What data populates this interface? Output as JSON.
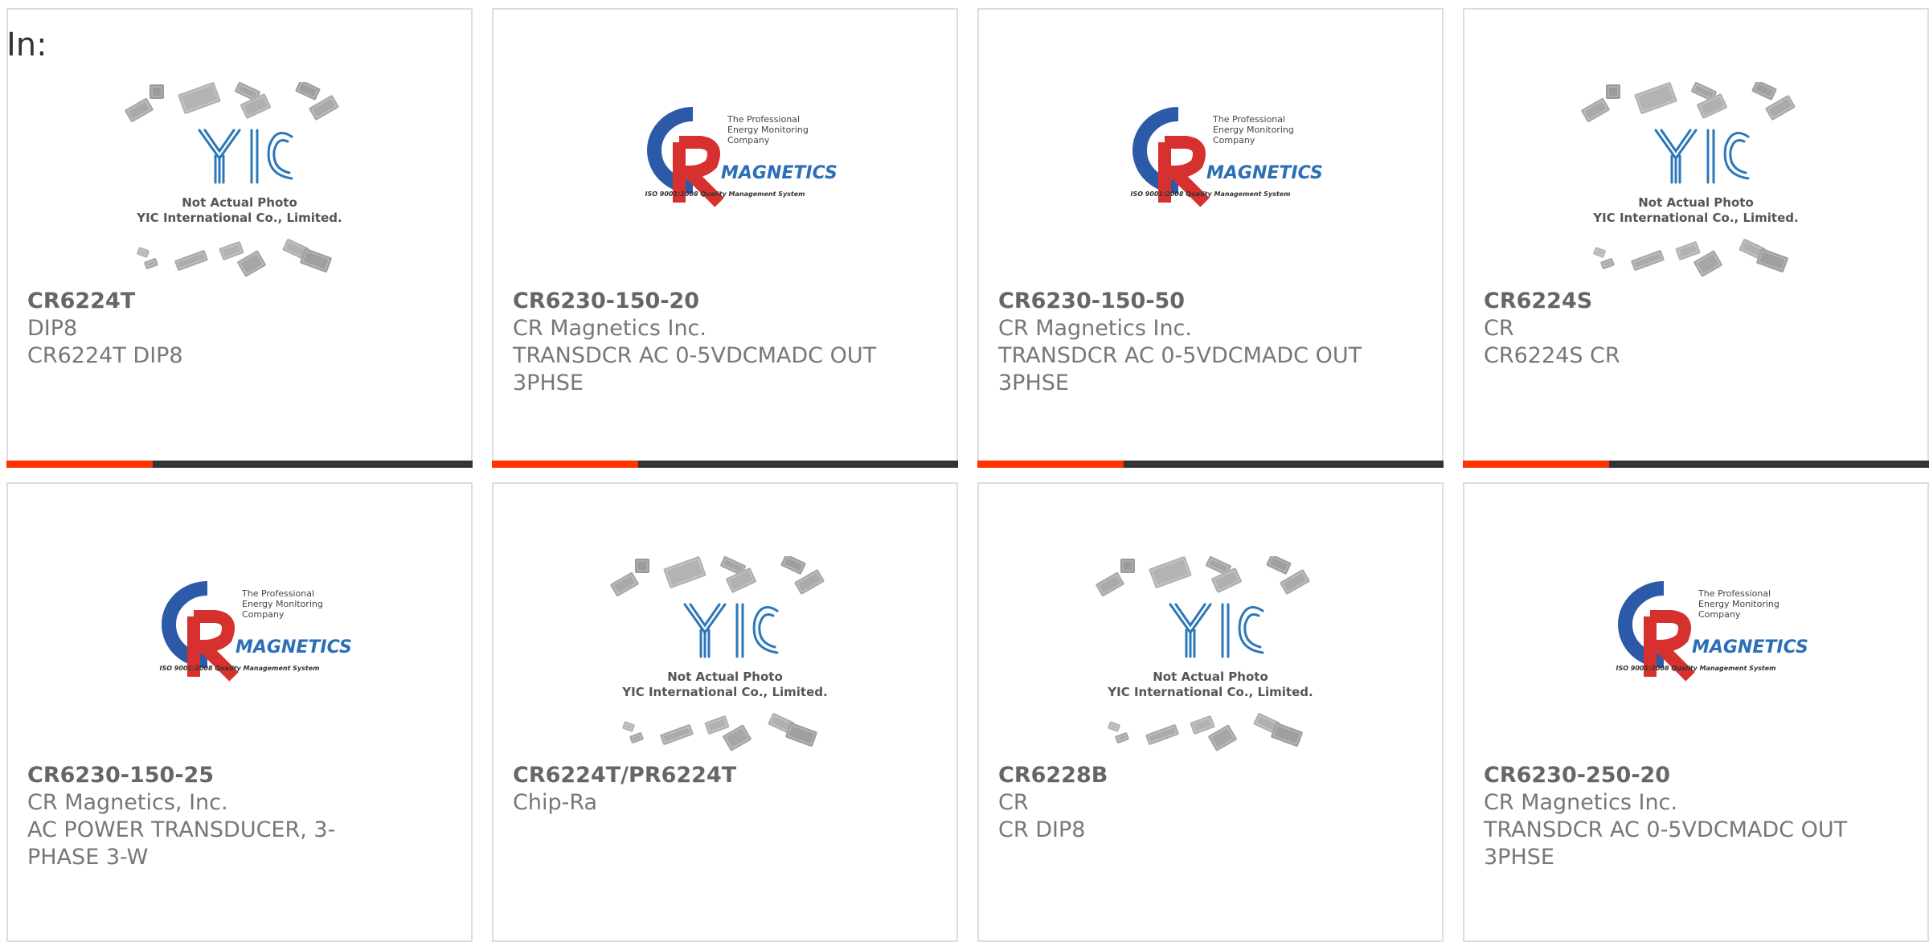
{
  "filter_label": "In:",
  "colors": {
    "accent": "#ff3300",
    "bar_dark": "#333333",
    "border": "#dddddd"
  },
  "products": [
    {
      "part_number": "CR6224T",
      "line1": "DIP8",
      "line2": "CR6224T DIP8",
      "line3": "",
      "image": "yic-placeholder",
      "image_text": [
        "Not Actual Photo",
        "YIC International Co., Limited."
      ]
    },
    {
      "part_number": "CR6230-150-20",
      "line1": "CR Magnetics Inc.",
      "line2": "TRANSDCR AC 0-5VDCMADC OUT",
      "line3": "3PHSE",
      "image": "cr-magnetics-logo",
      "image_text": [
        "The Professional",
        "Energy Monitoring",
        "Company",
        "MAGNETICS",
        "ISO 9001:2008 Quality Management System"
      ]
    },
    {
      "part_number": "CR6230-150-50",
      "line1": "CR Magnetics Inc.",
      "line2": "TRANSDCR AC 0-5VDCMADC OUT",
      "line3": "3PHSE",
      "image": "cr-magnetics-logo",
      "image_text": [
        "The Professional",
        "Energy Monitoring",
        "Company",
        "MAGNETICS",
        "ISO 9001:2008 Quality Management System"
      ]
    },
    {
      "part_number": "CR6224S",
      "line1": "CR",
      "line2": "CR6224S CR",
      "line3": "",
      "image": "yic-placeholder",
      "image_text": [
        "Not Actual Photo",
        "YIC International Co., Limited."
      ]
    },
    {
      "part_number": "CR6230-150-25",
      "line1": "CR Magnetics, Inc.",
      "line2": "AC POWER TRANSDUCER, 3-",
      "line3": "PHASE 3-W",
      "image": "cr-magnetics-logo",
      "image_text": [
        "The Professional",
        "Energy Monitoring",
        "Company",
        "MAGNETICS",
        "ISO 9001:2008 Quality Management System"
      ]
    },
    {
      "part_number": "CR6224T/PR6224T",
      "line1": "Chip-Ra",
      "line2": "",
      "line3": "",
      "image": "yic-placeholder",
      "image_text": [
        "Not Actual Photo",
        "YIC International Co., Limited."
      ]
    },
    {
      "part_number": "CR6228B",
      "line1": "CR",
      "line2": "CR DIP8",
      "line3": "",
      "image": "yic-placeholder",
      "image_text": [
        "Not Actual Photo",
        "YIC International Co., Limited."
      ]
    },
    {
      "part_number": "CR6230-250-20",
      "line1": "CR Magnetics Inc.",
      "line2": "TRANSDCR AC 0-5VDCMADC OUT",
      "line3": "3PHSE",
      "image": "cr-magnetics-logo",
      "image_text": [
        "The Professional",
        "Energy Monitoring",
        "Company",
        "MAGNETICS",
        "ISO 9001:2008 Quality Management System"
      ]
    }
  ]
}
